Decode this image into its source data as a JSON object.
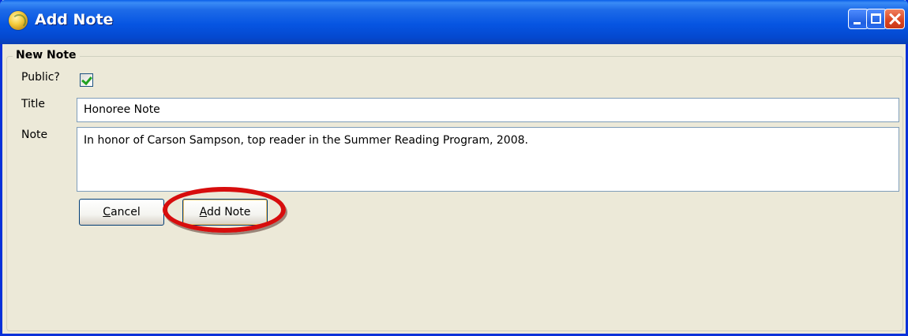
{
  "window": {
    "title": "Add Note",
    "icon": "app-globe-icon"
  },
  "titlebar_buttons": {
    "minimize_icon": "minimize-icon",
    "maximize_icon": "maximize-icon",
    "close_icon": "close-icon"
  },
  "form": {
    "group_title": "New Note",
    "public_label": "Public?",
    "public_checked": true,
    "title_label": "Title",
    "title_value": "Honoree Note",
    "note_label": "Note",
    "note_value": "In honor of Carson Sampson, top reader in the Summer Reading Program, 2008."
  },
  "buttons": {
    "cancel_mnemonic": "C",
    "cancel_rest": "ancel",
    "add_mnemonic": "A",
    "add_rest": "dd Note"
  },
  "colors": {
    "titlebar": "#0655e2",
    "window_bg": "#ece9d8",
    "highlight_ring": "#d70d0d",
    "checkmark": "#21a121"
  }
}
